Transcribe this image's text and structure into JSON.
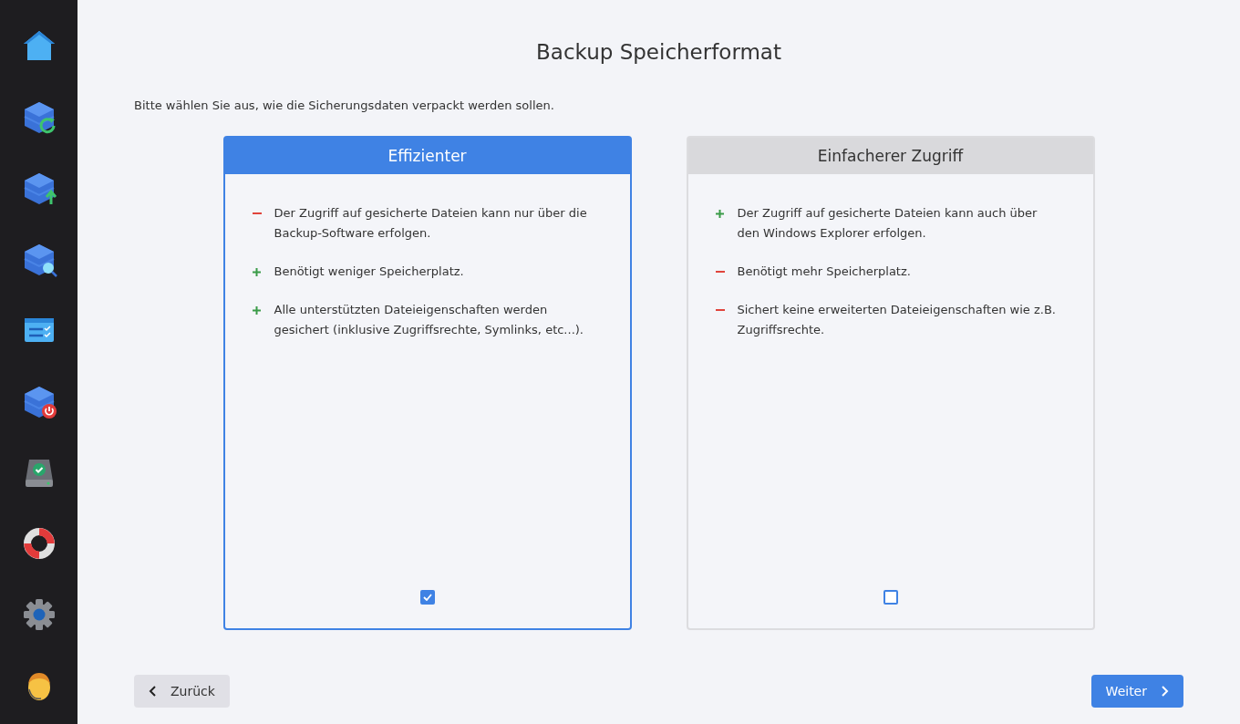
{
  "sidebar": {
    "items": [
      {
        "kind": "home"
      },
      {
        "kind": "box-refresh"
      },
      {
        "kind": "box-upload"
      },
      {
        "kind": "box-search"
      },
      {
        "kind": "checklist"
      },
      {
        "kind": "box-power"
      },
      {
        "kind": "drive-check"
      },
      {
        "kind": "lifebuoy"
      },
      {
        "kind": "gear"
      },
      {
        "kind": "support"
      }
    ]
  },
  "title": "Backup Speicherformat",
  "instruction": "Bitte wählen Sie aus, wie die Sicherungsdaten verpackt werden sollen.",
  "options": [
    {
      "title": "Effizienter",
      "selected": true,
      "checked": true,
      "points": [
        {
          "kind": "con",
          "text": "Der Zugriff auf gesicherte Dateien kann nur über die Backup-Software erfolgen."
        },
        {
          "kind": "pro",
          "text": "Benötigt weniger Speicherplatz."
        },
        {
          "kind": "pro",
          "text": "Alle unterstützten Dateieigenschaften werden gesichert (inklusive Zugriffsrechte, Symlinks, etc...)."
        }
      ]
    },
    {
      "title": "Einfacherer Zugriff",
      "selected": false,
      "checked": false,
      "points": [
        {
          "kind": "pro",
          "text": "Der Zugriff auf gesicherte Dateien kann auch über den Windows Explorer erfolgen."
        },
        {
          "kind": "con",
          "text": "Benötigt mehr Speicherplatz."
        },
        {
          "kind": "con",
          "text": "Sichert keine erweiterten Dateieigenschaften wie z.B. Zugriffsrechte."
        }
      ]
    }
  ],
  "buttons": {
    "back": "Zurück",
    "next": "Weiter"
  }
}
